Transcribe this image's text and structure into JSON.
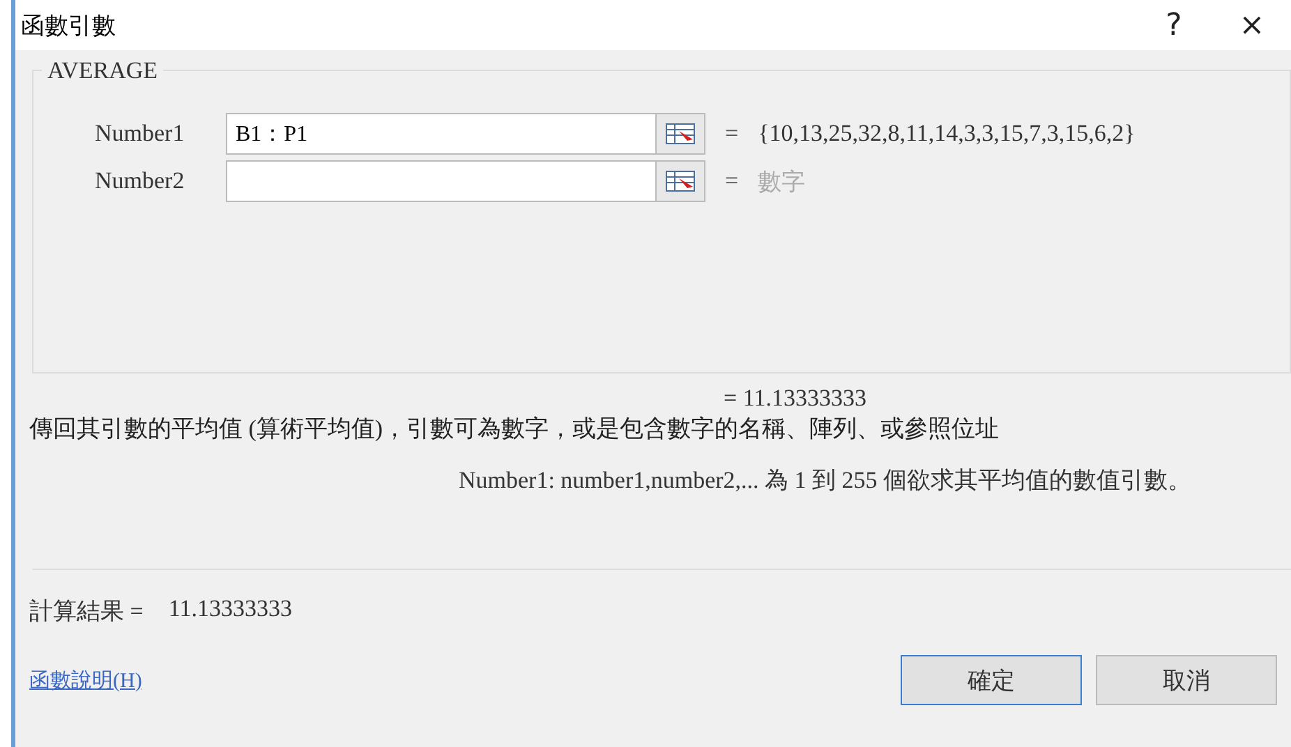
{
  "window": {
    "title": "函數引數",
    "help": "?",
    "close": "×"
  },
  "function": {
    "name": "AVERAGE",
    "args": [
      {
        "label": "Number1",
        "value": "B1：P1",
        "eq": "=",
        "result": "{10,13,25,32,8,11,14,3,3,15,7,3,15,6,2}",
        "hint": false
      },
      {
        "label": "Number2",
        "eq": "=",
        "result": "數字",
        "hint": true
      }
    ],
    "preview": "=  11.13333333"
  },
  "description": "傳回其引數的平均值 (算術平均值)，引數可為數字，或是包含數字的名稱、陣列、或參照位址",
  "arg_help": "Number1:   number1,number2,... 為 1 到 255 個欲求其平均值的數值引數。",
  "result": {
    "label": "計算結果 =",
    "value": "11.13333333"
  },
  "help_link": "函數說明(H)",
  "buttons": [
    {
      "label": "確定",
      "default": true
    },
    {
      "label": "取消",
      "default": false
    }
  ]
}
